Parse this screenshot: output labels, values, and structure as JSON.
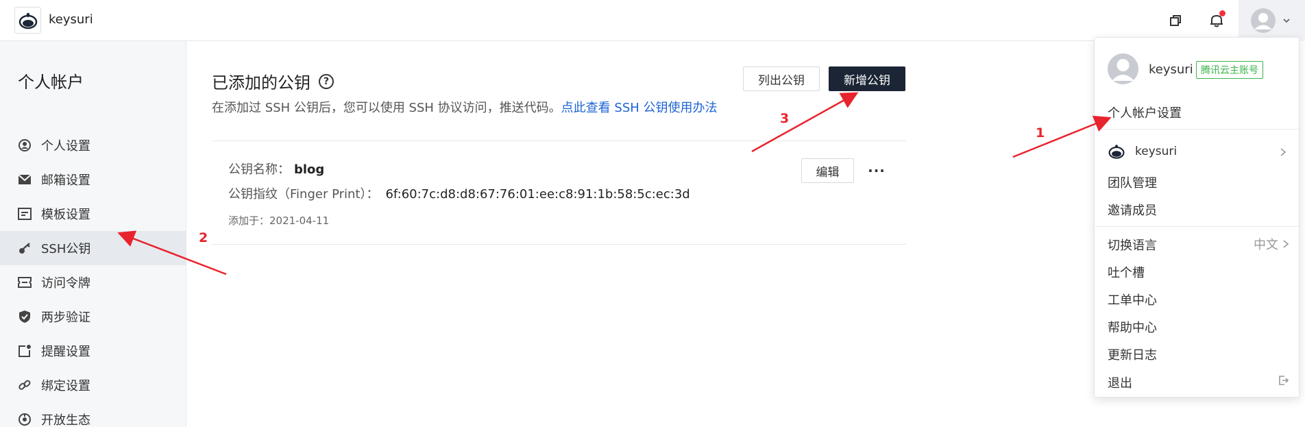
{
  "topbar": {
    "brand": "keysuri",
    "icons": [
      "window-icon",
      "bell-icon",
      "avatar-icon",
      "chevron-down-icon"
    ]
  },
  "sidebar": {
    "title": "个人帐户",
    "items": [
      {
        "label": "个人设置",
        "icon": "user-circle-icon"
      },
      {
        "label": "邮箱设置",
        "icon": "envelope-icon"
      },
      {
        "label": "模板设置",
        "icon": "template-icon"
      },
      {
        "label": "SSH公钥",
        "icon": "key-icon",
        "active": true
      },
      {
        "label": "访问令牌",
        "icon": "ticket-icon"
      },
      {
        "label": "两步验证",
        "icon": "shield-check-icon"
      },
      {
        "label": "提醒设置",
        "icon": "reminder-icon"
      },
      {
        "label": "绑定设置",
        "icon": "link-icon"
      },
      {
        "label": "开放生态",
        "icon": "ecosystem-icon"
      }
    ]
  },
  "main": {
    "title": "已添加的公钥",
    "help": "?",
    "desc_prefix": "在添加过 SSH 公钥后，您可以使用 SSH 协议访问，推送代码。",
    "desc_link": "点此查看 SSH 公钥使用办法",
    "list_button": "列出公钥",
    "add_button": "新增公钥",
    "key": {
      "name_label": "公钥名称：",
      "name": "blog",
      "fp_label": "公钥指纹（Finger Print）：",
      "fingerprint": "6f:60:7c:d8:d8:67:76:01:ee:c8:91:1b:58:5c:ec:3d",
      "added": "添加于：2021-04-11",
      "edit_button": "编辑",
      "more": "···"
    }
  },
  "dropdown": {
    "username": "keysuri",
    "badge": "腾讯云主账号",
    "account_settings": "个人帐户设置",
    "team_name": "keysuri",
    "team_manage": "团队管理",
    "invite": "邀请成员",
    "language": "切换语言",
    "language_value": "中文",
    "feedback": "吐个槽",
    "tickets": "工单中心",
    "help": "帮助中心",
    "changelog": "更新日志",
    "logout": "退出"
  },
  "annotations": {
    "n1": "1",
    "n2": "2",
    "n3": "3"
  },
  "colors": {
    "accent_dark": "#1b2535",
    "link": "#1e64d6",
    "annotation": "#e8232d",
    "badge": "#3ab54a",
    "notification": "#f0323c"
  }
}
